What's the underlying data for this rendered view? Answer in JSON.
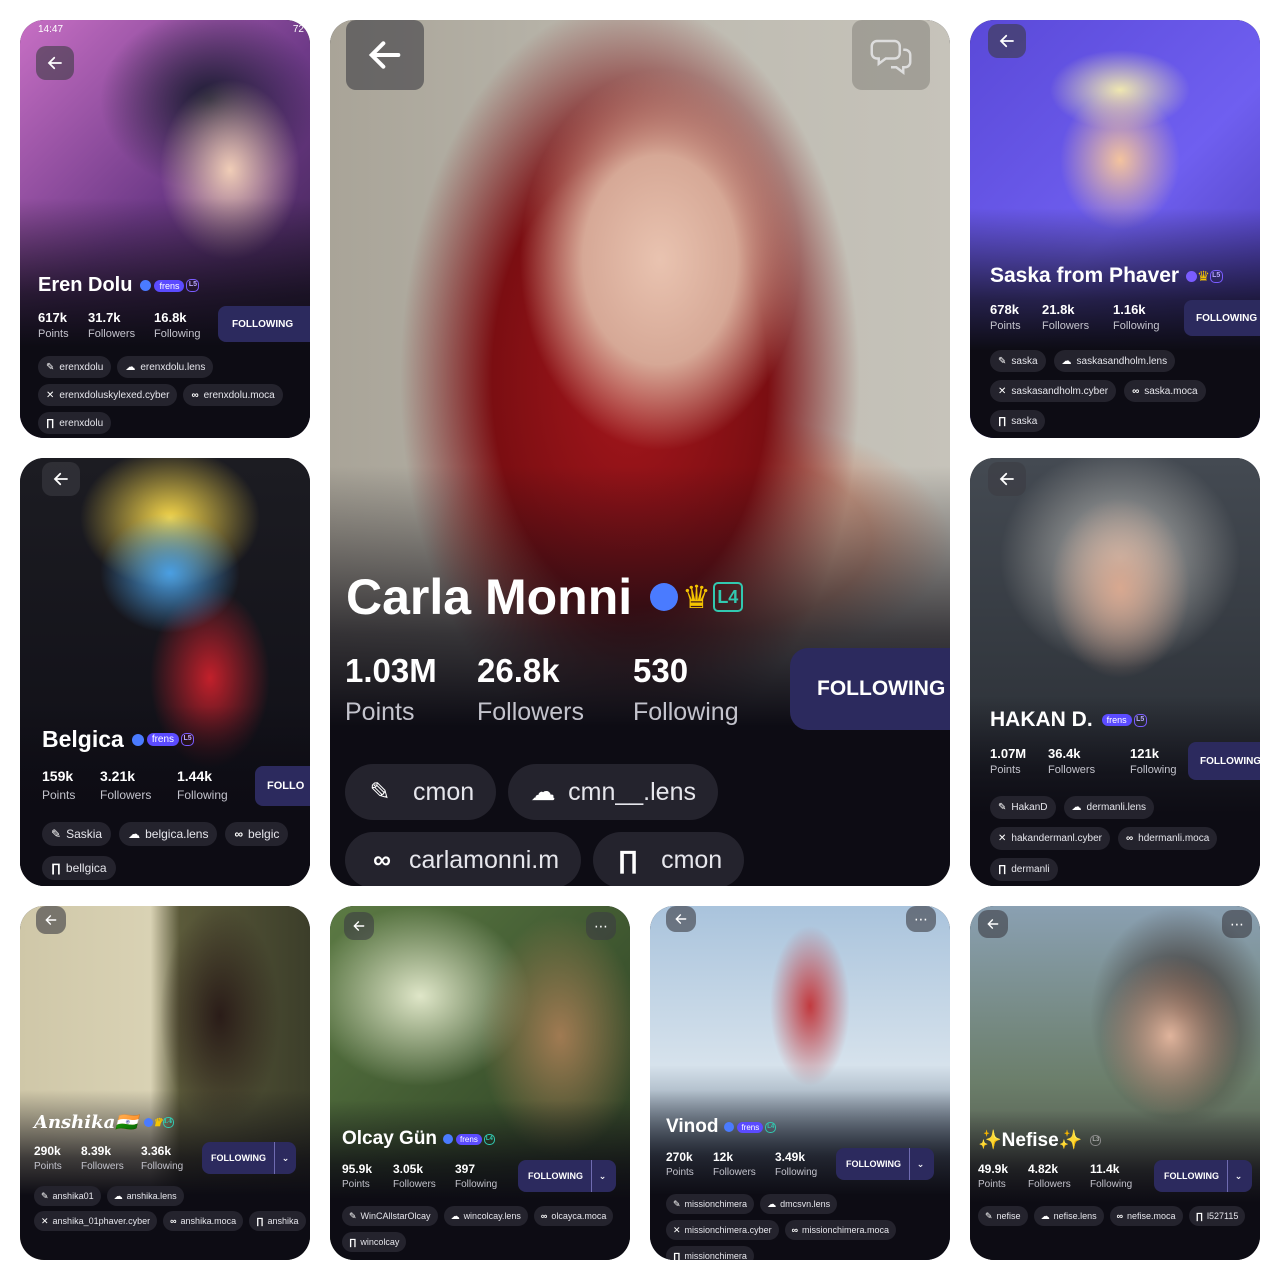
{
  "colors": {
    "accent": "#2c2a5e",
    "verified": "#4a7bff",
    "frens": "#5b4bff",
    "crown": "#f5c400",
    "card_bg": "#0d0c14"
  },
  "status_bar": {
    "time": "14:47",
    "battery": "72"
  },
  "main": {
    "name": "Carla Monni",
    "level": "L4",
    "stats": [
      {
        "value": "1.03M",
        "label": "Points"
      },
      {
        "value": "26.8k",
        "label": "Followers"
      },
      {
        "value": "530",
        "label": "Following"
      }
    ],
    "follow_label": "FOLLOWING",
    "chips": [
      {
        "icon": "chat-icon",
        "text": "cmon"
      },
      {
        "icon": "lens-icon",
        "text": "cmn__.lens"
      },
      {
        "icon": "moca-icon",
        "text": "carlamonni.m"
      },
      {
        "icon": "arch-icon",
        "text": "cmon"
      }
    ]
  },
  "eren": {
    "name": "Eren Dolu",
    "frens": "frens",
    "level": "L5",
    "stats": [
      {
        "value": "617k",
        "label": "Points"
      },
      {
        "value": "31.7k",
        "label": "Followers"
      },
      {
        "value": "16.8k",
        "label": "Following"
      }
    ],
    "follow_label": "FOLLOWING",
    "chips": [
      {
        "icon": "chat-icon",
        "text": "erenxdolu"
      },
      {
        "icon": "lens-icon",
        "text": "erenxdolu.lens"
      },
      {
        "icon": "cyber-icon",
        "text": "erenxdoluskylexed.cyber"
      },
      {
        "icon": "moca-icon",
        "text": "erenxdolu.moca"
      },
      {
        "icon": "arch-icon",
        "text": "erenxdolu"
      }
    ]
  },
  "saska": {
    "name": "Saska from Phaver",
    "level": "L5",
    "stats": [
      {
        "value": "678k",
        "label": "Points"
      },
      {
        "value": "21.8k",
        "label": "Followers"
      },
      {
        "value": "1.16k",
        "label": "Following"
      }
    ],
    "follow_label": "FOLLOWING",
    "chips": [
      {
        "icon": "chat-icon",
        "text": "saska"
      },
      {
        "icon": "lens-icon",
        "text": "saskasandholm.lens"
      },
      {
        "icon": "cyber-icon",
        "text": "saskasandholm.cyber"
      },
      {
        "icon": "moca-icon",
        "text": "saska.moca"
      },
      {
        "icon": "arch-icon",
        "text": "saska"
      }
    ]
  },
  "belgica": {
    "name": "Belgica",
    "frens": "frens",
    "level": "L5",
    "stats": [
      {
        "value": "159k",
        "label": "Points"
      },
      {
        "value": "3.21k",
        "label": "Followers"
      },
      {
        "value": "1.44k",
        "label": "Following"
      }
    ],
    "follow_label": "FOLLO",
    "chips": [
      {
        "icon": "chat-icon",
        "text": "Saskia"
      },
      {
        "icon": "lens-icon",
        "text": "belgica.lens"
      },
      {
        "icon": "moca-icon",
        "text": "belgic"
      },
      {
        "icon": "arch-icon",
        "text": "bellgica"
      }
    ]
  },
  "hakan": {
    "name": "HAKAN D.",
    "frens": "frens",
    "level": "L5",
    "stats": [
      {
        "value": "1.07M",
        "label": "Points"
      },
      {
        "value": "36.4k",
        "label": "Followers"
      },
      {
        "value": "121k",
        "label": "Following"
      }
    ],
    "follow_label": "FOLLOWING",
    "chips": [
      {
        "icon": "chat-icon",
        "text": "HakanD"
      },
      {
        "icon": "lens-icon",
        "text": "dermanli.lens"
      },
      {
        "icon": "cyber-icon",
        "text": "hakandermanl.cyber"
      },
      {
        "icon": "moca-icon",
        "text": "hdermanli.moca"
      },
      {
        "icon": "arch-icon",
        "text": "dermanli"
      }
    ]
  },
  "anshika": {
    "name": "Anshika🇮🇳",
    "level": "L4",
    "stats": [
      {
        "value": "290k",
        "label": "Points"
      },
      {
        "value": "8.39k",
        "label": "Followers"
      },
      {
        "value": "3.36k",
        "label": "Following"
      }
    ],
    "follow_label": "FOLLOWING",
    "chips": [
      {
        "icon": "chat-icon",
        "text": "anshika01"
      },
      {
        "icon": "lens-icon",
        "text": "anshika.lens"
      },
      {
        "icon": "cyber-icon",
        "text": "anshika_01phaver.cyber"
      },
      {
        "icon": "moca-icon",
        "text": "anshika.moca"
      },
      {
        "icon": "arch-icon",
        "text": "anshika"
      }
    ]
  },
  "olcay": {
    "name": "Olcay Gün",
    "frens": "frens",
    "level": "L4",
    "stats": [
      {
        "value": "95.9k",
        "label": "Points"
      },
      {
        "value": "3.05k",
        "label": "Followers"
      },
      {
        "value": "397",
        "label": "Following"
      }
    ],
    "follow_label": "FOLLOWING",
    "chips": [
      {
        "icon": "chat-icon",
        "text": "WinCAllstarOlcay"
      },
      {
        "icon": "lens-icon",
        "text": "wincolcay.lens"
      },
      {
        "icon": "moca-icon",
        "text": "olcayca.moca"
      },
      {
        "icon": "arch-icon",
        "text": "wincolcay"
      }
    ]
  },
  "vinod": {
    "name": "Vinod",
    "frens": "frens",
    "level": "L4",
    "stats": [
      {
        "value": "270k",
        "label": "Points"
      },
      {
        "value": "12k",
        "label": "Followers"
      },
      {
        "value": "3.49k",
        "label": "Following"
      }
    ],
    "follow_label": "FOLLOWING",
    "chips": [
      {
        "icon": "chat-icon",
        "text": "missionchimera"
      },
      {
        "icon": "lens-icon",
        "text": "dmcsvn.lens"
      },
      {
        "icon": "cyber-icon",
        "text": "missionchimera.cyber"
      },
      {
        "icon": "moca-icon",
        "text": "missionchimera.moca"
      },
      {
        "icon": "arch-icon",
        "text": "missionchimera"
      }
    ]
  },
  "nefise": {
    "name": "✨Nefise✨",
    "level": "L3",
    "stats": [
      {
        "value": "49.9k",
        "label": "Points"
      },
      {
        "value": "4.82k",
        "label": "Followers"
      },
      {
        "value": "11.4k",
        "label": "Following"
      }
    ],
    "follow_label": "FOLLOWING",
    "chips": [
      {
        "icon": "chat-icon",
        "text": "nefise"
      },
      {
        "icon": "lens-icon",
        "text": "nefise.lens"
      },
      {
        "icon": "moca-icon",
        "text": "nefise.moca"
      },
      {
        "icon": "arch-icon",
        "text": "l527115"
      }
    ]
  }
}
